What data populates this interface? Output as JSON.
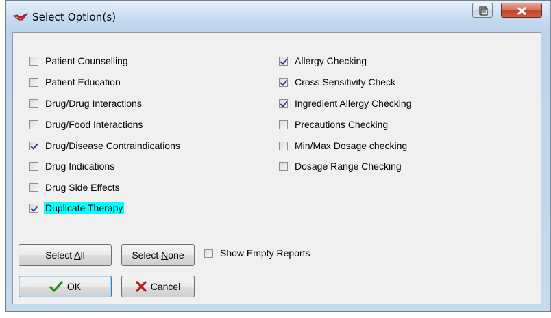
{
  "window": {
    "title": "Select Option(s)",
    "title_icon": "red-pill-icon",
    "help_icon": "help-icon",
    "close_icon": "close-x-icon",
    "close_color": "#c0432c"
  },
  "options_left": [
    {
      "label": "Patient Counselling",
      "checked": false
    },
    {
      "label": "Patient Education",
      "checked": false
    },
    {
      "label": "Drug/Drug Interactions",
      "checked": false
    },
    {
      "label": "Drug/Food Interactions",
      "checked": false
    },
    {
      "label": "Drug/Disease Contraindications",
      "checked": true
    },
    {
      "label": "Drug Indications",
      "checked": false
    },
    {
      "label": "Drug Side Effects",
      "checked": false
    },
    {
      "label": "Duplicate Therapy",
      "checked": true,
      "highlighted": true
    }
  ],
  "options_right": [
    {
      "label": "Allergy Checking",
      "checked": true
    },
    {
      "label": "Cross Sensitivity Check",
      "checked": true
    },
    {
      "label": "Ingredient Allergy Checking",
      "checked": true
    },
    {
      "label": "Precautions Checking",
      "checked": false
    },
    {
      "label": "Min/Max Dosage checking",
      "checked": false
    },
    {
      "label": "Dosage Range Checking",
      "checked": false
    }
  ],
  "highlight_color": "#00ffff",
  "buttons": {
    "select_all_prefix": "Select ",
    "select_all_key": "A",
    "select_all_suffix": "ll",
    "select_none_prefix": "Select ",
    "select_none_key": "N",
    "select_none_suffix": "one",
    "show_empty_label": "Show Empty Reports",
    "show_empty_checked": false,
    "ok_label": "OK",
    "cancel_label": "Cancel",
    "ok_icon": "checkmark-icon",
    "cancel_icon": "x-icon"
  }
}
